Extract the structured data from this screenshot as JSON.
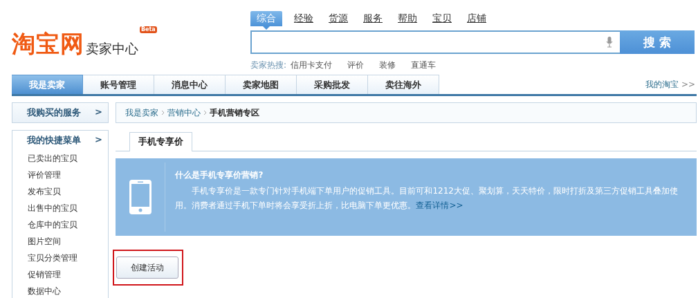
{
  "logo": {
    "brand": "淘宝网",
    "subtitle": "卖家中心",
    "badge": "Beta"
  },
  "search": {
    "tabs": [
      {
        "label": "综合",
        "selected": true
      },
      {
        "label": "经验",
        "selected": false
      },
      {
        "label": "货源",
        "selected": false
      },
      {
        "label": "服务",
        "selected": false
      },
      {
        "label": "帮助",
        "selected": false
      },
      {
        "label": "宝贝",
        "selected": false
      },
      {
        "label": "店铺",
        "selected": false
      }
    ],
    "button": "搜 索",
    "hot_label": "卖家热搜:",
    "hot_items": [
      "信用卡支付",
      "评价",
      "装修",
      "直通车"
    ]
  },
  "nav": {
    "tabs": [
      {
        "label": "我是卖家",
        "selected": true
      },
      {
        "label": "账号管理",
        "selected": false
      },
      {
        "label": "消息中心",
        "selected": false
      },
      {
        "label": "卖家地图",
        "selected": false
      },
      {
        "label": "采购批发",
        "selected": false
      },
      {
        "label": "卖往海外",
        "selected": false
      }
    ],
    "my_link": "我的淘宝",
    "my_arrow": ">>"
  },
  "sidebar": {
    "sections": [
      {
        "title": "我购买的服务",
        "arrow": ">"
      },
      {
        "title": "我的快捷菜单",
        "arrow": ">",
        "items": [
          "已卖出的宝贝",
          "评价管理",
          "发布宝贝",
          "出售中的宝贝",
          "仓库中的宝贝",
          "图片空间",
          "宝贝分类管理",
          "促销管理",
          "数据中心"
        ]
      }
    ]
  },
  "breadcrumb": [
    {
      "label": "我是卖家",
      "current": false
    },
    {
      "label": "营销中心",
      "current": false
    },
    {
      "label": "手机营销专区",
      "current": true
    }
  ],
  "content_tabs": [
    {
      "label": "手机专享价",
      "selected": true
    }
  ],
  "info": {
    "title": "什么是手机专享价营销?",
    "body": "手机专享价是一款专门针对手机端下单用户的促销工具。目前可和1212大促、聚划算，天天特价，限时打折及第三方促销工具叠加使用。消费者通过手机下单时将会享受折上折，比电脑下单更优惠。",
    "link": "查看详情>>"
  },
  "action_button": {
    "label": "创建活动",
    "highlighted": true
  }
}
